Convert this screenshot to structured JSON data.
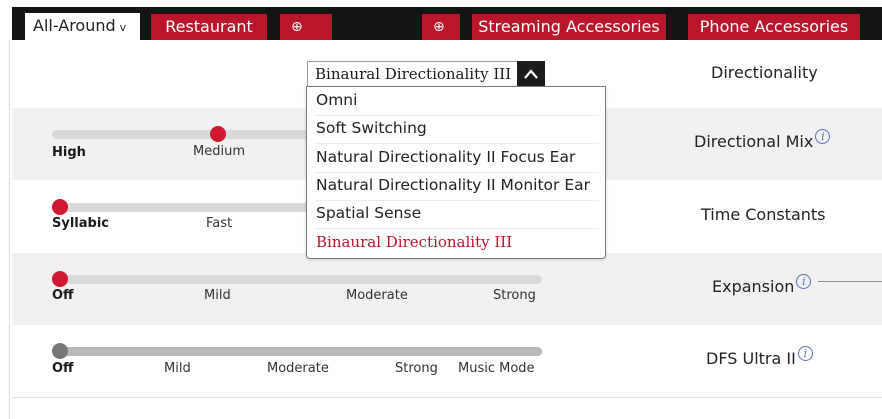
{
  "tabs": {
    "active_label": "All-Around",
    "active_chevron": "v",
    "restaurant": "Restaurant",
    "add_1": "⊕",
    "add_2": "⊕",
    "streaming": "Streaming Accessories",
    "phone": "Phone Accessories"
  },
  "directionality": {
    "label": "Directionality",
    "dropdown_value": "Binaural Directionality III",
    "options": [
      "Omni",
      "Soft Switching",
      "Natural Directionality II Focus Ear",
      "Natural Directionality II Monitor Ear",
      "Spatial Sense",
      "Binaural Directionality III"
    ],
    "selected_option": "Binaural Directionality III"
  },
  "directional_mix": {
    "label": "Directional Mix",
    "info": "i",
    "stops": [
      "High",
      "Medium"
    ],
    "selected_stop": "Medium"
  },
  "time_constants": {
    "label": "Time Constants",
    "stops": [
      "Syllabic",
      "Fast"
    ],
    "selected_stop": "Syllabic"
  },
  "expansion": {
    "label": "Expansion",
    "info": "i",
    "stops": [
      "Off",
      "Mild",
      "Moderate",
      "Strong"
    ],
    "selected_stop": "Off"
  },
  "dfs": {
    "label": "DFS Ultra II",
    "info": "i",
    "stops": [
      "Off",
      "Mild",
      "Moderate",
      "Strong",
      "Music Mode"
    ],
    "selected_stop": "Off"
  },
  "colors": {
    "accent_red": "#b9162c",
    "knob_red": "#d0182e",
    "tab_bar_black": "#141414",
    "row_shade": "#f1f1f1",
    "info_blue": "#5a6fb8"
  }
}
